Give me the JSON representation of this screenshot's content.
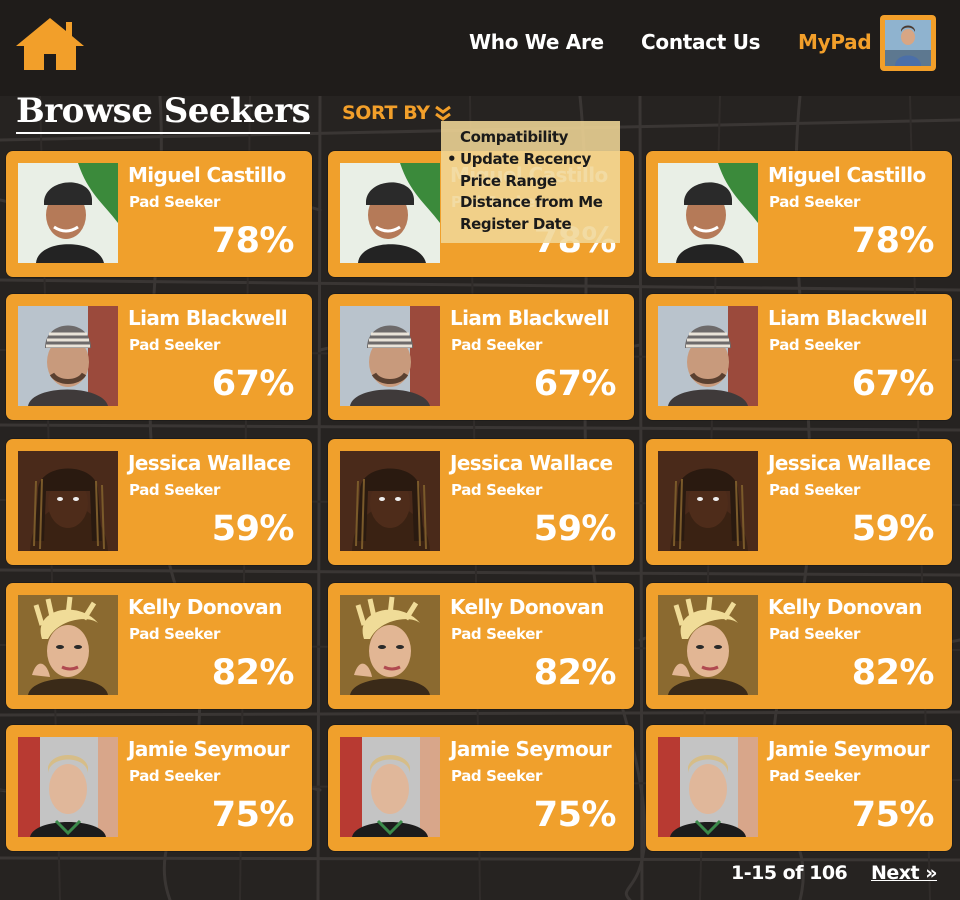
{
  "nav": {
    "home_icon": "home-icon",
    "who_we_are": "Who We Are",
    "contact_us": "Contact Us",
    "mypad": "MyPad"
  },
  "page": {
    "title": "Browse Seekers",
    "sort_label": "SORT BY",
    "sort_icon": "double-chevron-down-icon"
  },
  "sort_menu": {
    "options": [
      {
        "label": "Compatibility",
        "selected": false
      },
      {
        "label": "Update Recency",
        "selected": true
      },
      {
        "label": "Price Range",
        "selected": false
      },
      {
        "label": "Distance from Me",
        "selected": false
      },
      {
        "label": "Register Date",
        "selected": false
      }
    ],
    "bullet": "•"
  },
  "rows": [
    {
      "name": "Miguel Castillo",
      "role": "Pad Seeker",
      "match": "78%",
      "photo": "miguel"
    },
    {
      "name": "Liam Blackwell",
      "role": "Pad Seeker",
      "match": "67%",
      "photo": "liam"
    },
    {
      "name": "Jessica Wallace",
      "role": "Pad Seeker",
      "match": "59%",
      "photo": "jessica"
    },
    {
      "name": "Kelly Donovan",
      "role": "Pad Seeker",
      "match": "82%",
      "photo": "kelly"
    },
    {
      "name": "Jamie Seymour",
      "role": "Pad Seeker",
      "match": "75%",
      "photo": "jamie"
    }
  ],
  "pagination": {
    "range": "1-15 of 106",
    "next": "Next »"
  },
  "colors": {
    "accent": "#f29f2a",
    "card": "#f0a02c",
    "background": "#262321"
  }
}
